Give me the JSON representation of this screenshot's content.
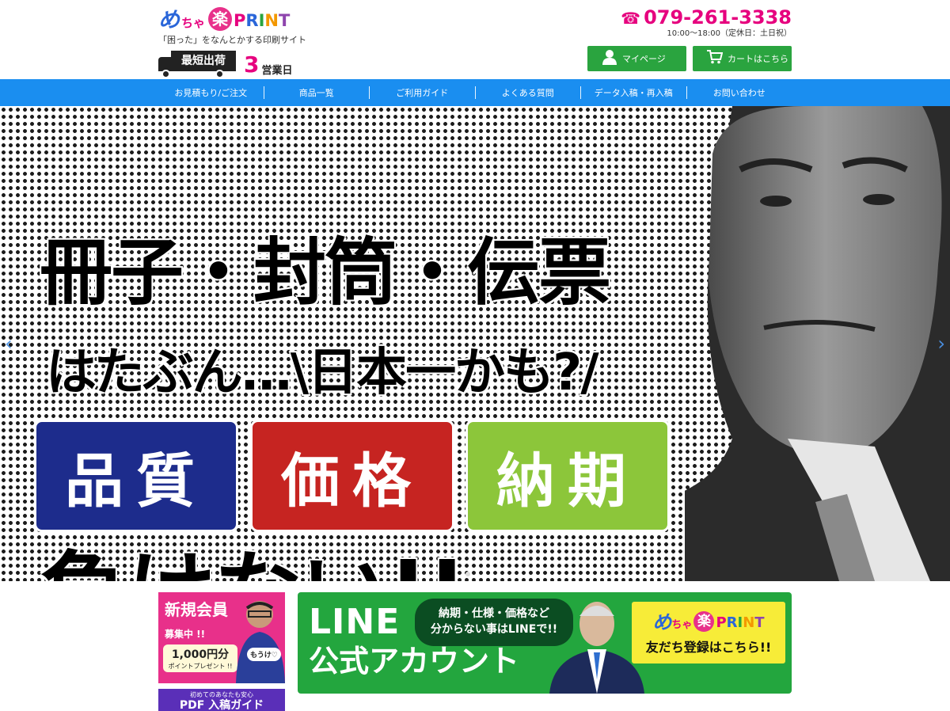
{
  "logo": {
    "me": "め",
    "cha": "ちゃ",
    "raku": "楽",
    "print_letters": [
      {
        "ch": "P",
        "color": "#e6007e"
      },
      {
        "ch": "R",
        "color": "#2a66d9"
      },
      {
        "ch": "I",
        "color": "#2aa43f"
      },
      {
        "ch": "N",
        "color": "#f39800"
      },
      {
        "ch": "T",
        "color": "#8e44ad"
      }
    ],
    "tagline": "「困った」をなんとかする印刷サイト"
  },
  "shipping": {
    "badge": "最短出荷",
    "days": "3",
    "unit": "営業日"
  },
  "contact": {
    "phone_icon": "☎",
    "phone": "079-261-3338",
    "hours": "10:00〜18:00（定休日：土日祝）"
  },
  "header_buttons": {
    "mypage": {
      "icon": "person-icon",
      "label": "マイページ"
    },
    "cart": {
      "icon": "cart-icon",
      "label": "カートはこちら"
    }
  },
  "nav": {
    "items": [
      "お見積もり/ご注文",
      "商品一覧",
      "ご利用ガイド",
      "よくある質問",
      "データ入稿・再入稿",
      "お問い合わせ"
    ]
  },
  "hero": {
    "line1": "冊子・封筒・伝票",
    "line2": "はたぶん…\\日本一かも?/",
    "keywords": [
      "品質",
      "価格",
      "納期"
    ],
    "line3": "負けない!!",
    "arrow_left": "‹",
    "arrow_right": "›",
    "colors": {
      "quality": "#1d2c8c",
      "price": "#c62421",
      "delivery": "#8cc63a"
    }
  },
  "member_banner": {
    "title": "新規会員",
    "sub": "募集中 !!",
    "points": "1,000円分",
    "points_sub": "ポイントプレゼント !!",
    "bubble": "もうけ♡"
  },
  "pdf_banner": {
    "sub": "初めてのあなたも安心",
    "title": "PDF 入稿ガイド"
  },
  "line_banner": {
    "title1": "LINE",
    "title2": "公式アカウント",
    "bubble_l1": "納期・仕様・価格など",
    "bubble_l2": "分からない事はLINEで!!",
    "cta_logo_me": "め",
    "cta_logo_cha": "ちゃ",
    "cta_logo_raku": "楽",
    "cta_logo_print": "PRINT",
    "cta_text": "友だち登録はこちら!!"
  }
}
